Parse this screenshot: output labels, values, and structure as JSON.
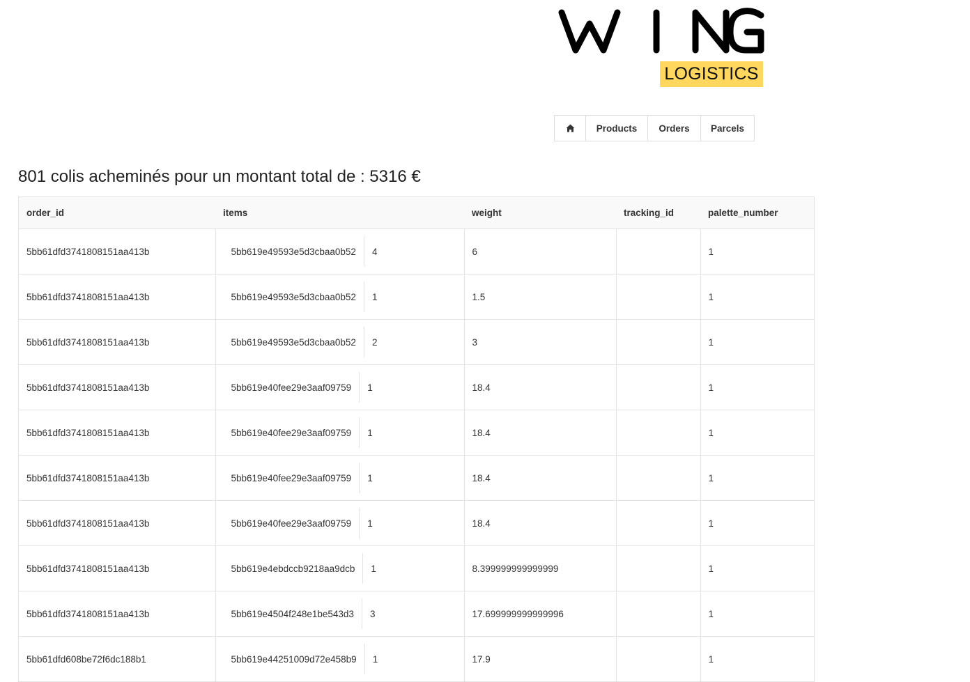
{
  "brand": {
    "name": "WING",
    "subtitle": "LOGISTICS",
    "accent_color": "#ffd75e"
  },
  "nav": {
    "home_icon": "home-icon",
    "items": [
      {
        "label": "Products"
      },
      {
        "label": "Orders"
      },
      {
        "label": "Parcels"
      }
    ]
  },
  "summary": "801 colis acheminés pour un montant total de : 5316 €",
  "table": {
    "headers": [
      "order_id",
      "items",
      "weight",
      "tracking_id",
      "palette_number"
    ],
    "rows": [
      {
        "order_id": "5bb61dfd3741808151aa413b",
        "item_id": "5bb619e49593e5d3cbaa0b52",
        "qty": "4",
        "weight": "6",
        "tracking_id": "",
        "palette_number": "1"
      },
      {
        "order_id": "5bb61dfd3741808151aa413b",
        "item_id": "5bb619e49593e5d3cbaa0b52",
        "qty": "1",
        "weight": "1.5",
        "tracking_id": "",
        "palette_number": "1"
      },
      {
        "order_id": "5bb61dfd3741808151aa413b",
        "item_id": "5bb619e49593e5d3cbaa0b52",
        "qty": "2",
        "weight": "3",
        "tracking_id": "",
        "palette_number": "1"
      },
      {
        "order_id": "5bb61dfd3741808151aa413b",
        "item_id": "5bb619e40fee29e3aaf09759",
        "qty": "1",
        "weight": "18.4",
        "tracking_id": "",
        "palette_number": "1"
      },
      {
        "order_id": "5bb61dfd3741808151aa413b",
        "item_id": "5bb619e40fee29e3aaf09759",
        "qty": "1",
        "weight": "18.4",
        "tracking_id": "",
        "palette_number": "1"
      },
      {
        "order_id": "5bb61dfd3741808151aa413b",
        "item_id": "5bb619e40fee29e3aaf09759",
        "qty": "1",
        "weight": "18.4",
        "tracking_id": "",
        "palette_number": "1"
      },
      {
        "order_id": "5bb61dfd3741808151aa413b",
        "item_id": "5bb619e40fee29e3aaf09759",
        "qty": "1",
        "weight": "18.4",
        "tracking_id": "",
        "palette_number": "1"
      },
      {
        "order_id": "5bb61dfd3741808151aa413b",
        "item_id": "5bb619e4ebdccb9218aa9dcb",
        "qty": "1",
        "weight": "8.399999999999999",
        "tracking_id": "",
        "palette_number": "1"
      },
      {
        "order_id": "5bb61dfd3741808151aa413b",
        "item_id": "5bb619e4504f248e1be543d3",
        "qty": "3",
        "weight": "17.699999999999996",
        "tracking_id": "",
        "palette_number": "1"
      },
      {
        "order_id": "5bb61dfd608be72f6dc188b1",
        "item_id": "5bb619e44251009d72e458b9",
        "qty": "1",
        "weight": "17.9",
        "tracking_id": "",
        "palette_number": "1"
      }
    ]
  }
}
